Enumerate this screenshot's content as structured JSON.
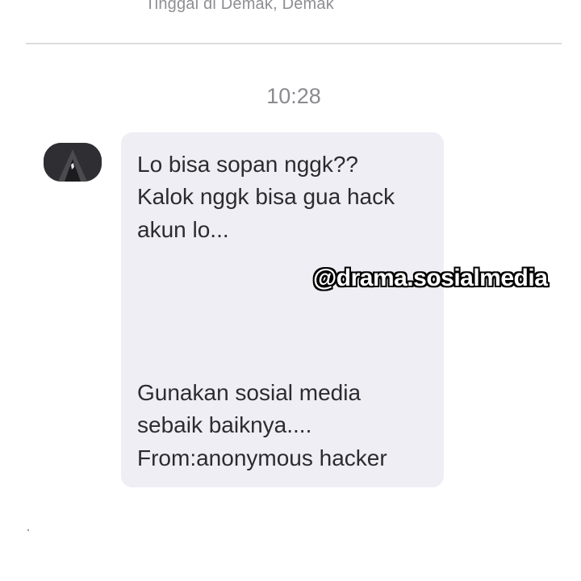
{
  "header": {
    "location": "Tinggal di Demak, Demak"
  },
  "conversation": {
    "timestamp": "10:28",
    "message": {
      "lines": [
        "Lo bisa sopan nggk??",
        "Kalok nggk bisa gua hack",
        "akun lo...",
        "Gunakan sosial media",
        "sebaik baiknya....",
        "From:anonymous hacker"
      ]
    }
  },
  "overlay": {
    "watermark": "@drama.sosialmedia"
  },
  "colors": {
    "bubble": "#eeeef4",
    "text": "#2c2c30",
    "muted": "#8a8a8f",
    "avatar": "#2f2f33"
  },
  "icons": {
    "avatar": "hooded-figure-avatar-icon"
  }
}
